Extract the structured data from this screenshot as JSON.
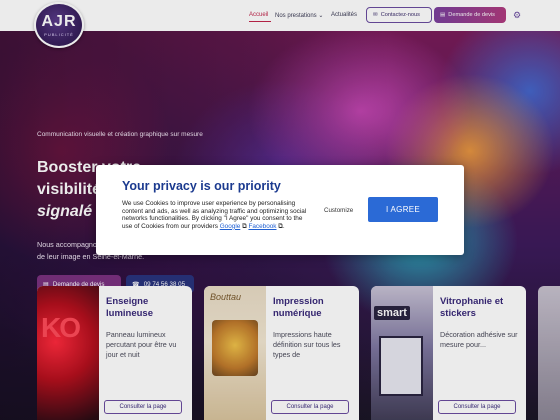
{
  "header": {
    "logo": {
      "text": "AJR",
      "sub": "PUBLICITÉ"
    },
    "nav": [
      {
        "label": "Accueil",
        "active": true
      },
      {
        "label": "Nos prestations ⌄",
        "active": false
      },
      {
        "label": "Actualités",
        "active": false
      }
    ],
    "contact_label": "Contactez-nous",
    "devis_label": "Demande de devis",
    "lang_icon": "gear-icon",
    "accent": "#c0244a",
    "brand": "#6b4da0"
  },
  "hero": {
    "subtitle": "Communication visuelle et création graphique sur mesure",
    "title_line1": "Booster votre",
    "title_line2": "visibilité",
    "title_line3": "signalé",
    "description_line1": "Nous accompagnons",
    "description_line2": "de leur image en Seine-et-Marne.",
    "devis_label": "Demande de devis",
    "phone_label": "09 74 56 38 05"
  },
  "cards": [
    {
      "title": "Enseigne lumineuse",
      "text": "Panneau lumineux percutant pour être vu jour et nuit",
      "button": "Consulter la page",
      "img_text": "KO"
    },
    {
      "title": "Impression numérique",
      "text": "Impressions haute définition sur tous les types de",
      "button": "Consulter la page",
      "img_text": "Bouttau"
    },
    {
      "title": "Vitrophanie et stickers",
      "text": "Décoration adhésive sur mesure pour...",
      "button": "Consulter la page",
      "img_text": "smart"
    }
  ],
  "modal": {
    "title": "Your privacy is our priority",
    "text": "We use Cookies to improve user experience by personalising content and ads, as well as analyzing traffic and optimizing social networks functionalities. By clicking \"I Agree\" you consent to the use of Cookies from our providers",
    "link_google": "Google",
    "link_facebook": "Facebook",
    "customize_label": "Customize",
    "agree_label": "I AGREE",
    "title_color": "#1b3a8f",
    "button_color": "#2b6ad6"
  }
}
